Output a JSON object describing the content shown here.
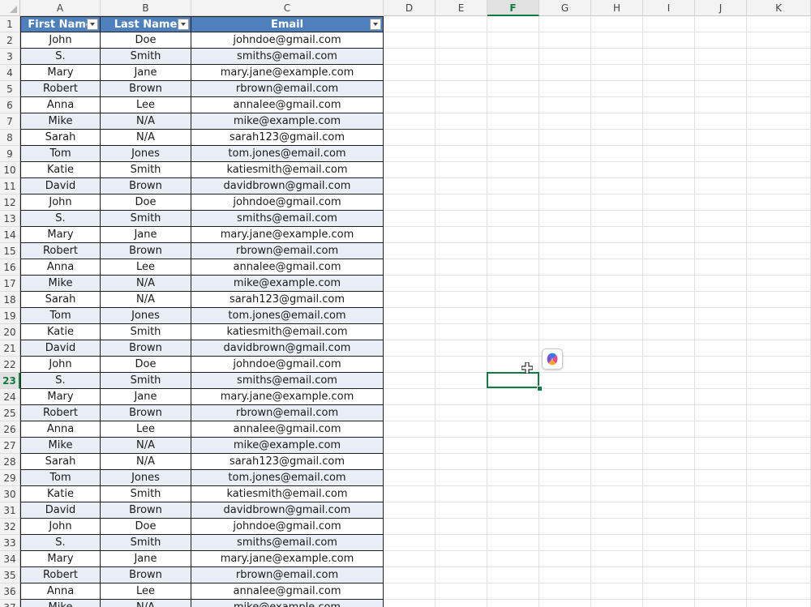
{
  "columns": [
    "A",
    "B",
    "C",
    "D",
    "E",
    "F",
    "G",
    "H",
    "I",
    "J",
    "K"
  ],
  "selected_column": "F",
  "selected_row": 23,
  "table": {
    "headers": [
      "First Name",
      "Last Name",
      "Email"
    ],
    "rows": [
      [
        "John",
        "Doe",
        "johndoe@gmail.com"
      ],
      [
        "S.",
        "Smith",
        "smiths@email.com"
      ],
      [
        "Mary",
        "Jane",
        "mary.jane@example.com"
      ],
      [
        "Robert",
        "Brown",
        "rbrown@email.com"
      ],
      [
        "Anna",
        "Lee",
        "annalee@gmail.com"
      ],
      [
        "Mike",
        "N/A",
        "mike@example.com"
      ],
      [
        "Sarah",
        "N/A",
        "sarah123@gmail.com"
      ],
      [
        "Tom",
        "Jones",
        "tom.jones@email.com"
      ],
      [
        "Katie",
        "Smith",
        "katiesmith@email.com"
      ],
      [
        "David",
        "Brown",
        "davidbrown@gmail.com"
      ],
      [
        "John",
        "Doe",
        "johndoe@gmail.com"
      ],
      [
        "S.",
        "Smith",
        "smiths@email.com"
      ],
      [
        "Mary",
        "Jane",
        "mary.jane@example.com"
      ],
      [
        "Robert",
        "Brown",
        "rbrown@email.com"
      ],
      [
        "Anna",
        "Lee",
        "annalee@gmail.com"
      ],
      [
        "Mike",
        "N/A",
        "mike@example.com"
      ],
      [
        "Sarah",
        "N/A",
        "sarah123@gmail.com"
      ],
      [
        "Tom",
        "Jones",
        "tom.jones@email.com"
      ],
      [
        "Katie",
        "Smith",
        "katiesmith@email.com"
      ],
      [
        "David",
        "Brown",
        "davidbrown@gmail.com"
      ],
      [
        "John",
        "Doe",
        "johndoe@gmail.com"
      ],
      [
        "S.",
        "Smith",
        "smiths@email.com"
      ],
      [
        "Mary",
        "Jane",
        "mary.jane@example.com"
      ],
      [
        "Robert",
        "Brown",
        "rbrown@email.com"
      ],
      [
        "Anna",
        "Lee",
        "annalee@gmail.com"
      ],
      [
        "Mike",
        "N/A",
        "mike@example.com"
      ],
      [
        "Sarah",
        "N/A",
        "sarah123@gmail.com"
      ],
      [
        "Tom",
        "Jones",
        "tom.jones@email.com"
      ],
      [
        "Katie",
        "Smith",
        "katiesmith@email.com"
      ],
      [
        "David",
        "Brown",
        "davidbrown@gmail.com"
      ],
      [
        "John",
        "Doe",
        "johndoe@gmail.com"
      ],
      [
        "S.",
        "Smith",
        "smiths@email.com"
      ],
      [
        "Mary",
        "Jane",
        "mary.jane@example.com"
      ],
      [
        "Robert",
        "Brown",
        "rbrown@email.com"
      ],
      [
        "Anna",
        "Lee",
        "annalee@gmail.com"
      ],
      [
        "Mike",
        "N/A",
        "mike@example.com"
      ]
    ]
  },
  "colors": {
    "header_fill": "#4e80bd",
    "band_fill": "#e9eef6",
    "selection": "#107c41"
  }
}
